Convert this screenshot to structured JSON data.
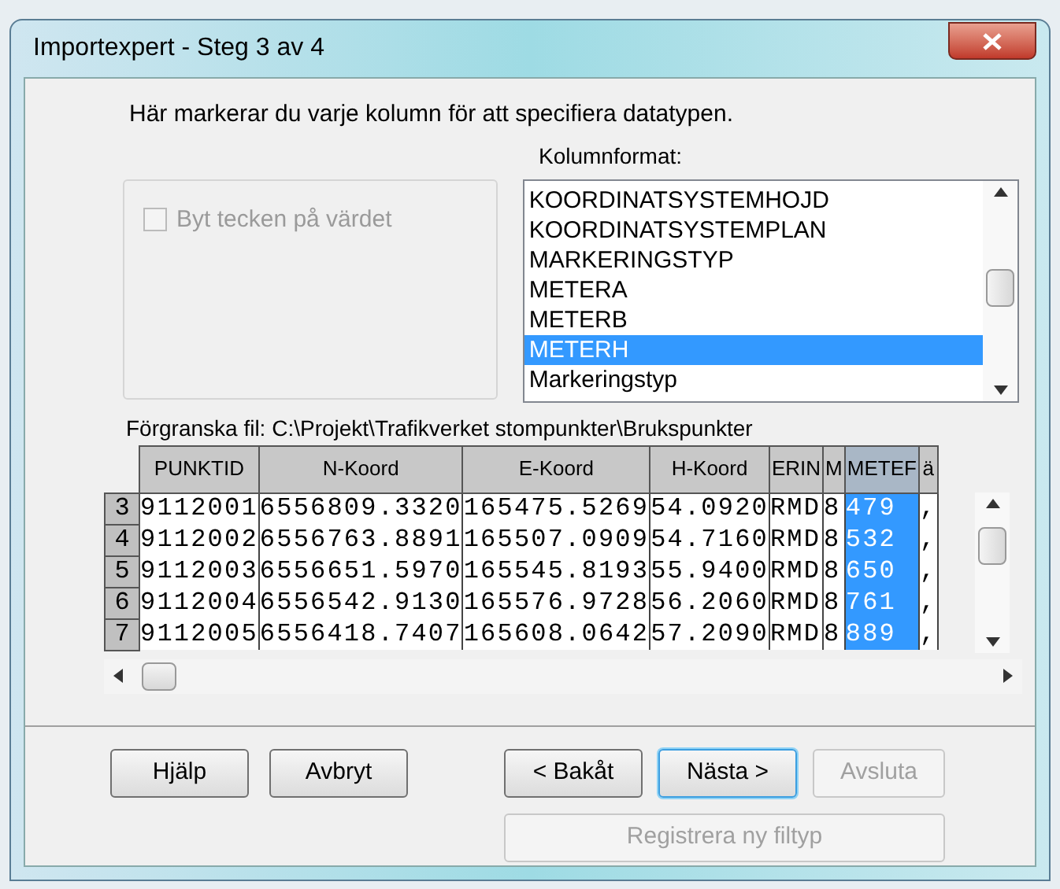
{
  "window": {
    "title": "Importexpert - Steg 3 av 4"
  },
  "instruction": "Här markerar du varje kolumn för att specifiera datatypen.",
  "column_format": {
    "label": "Kolumnformat:",
    "items": [
      {
        "label": "KOORDINATSYSTEMHOJD",
        "selected": false
      },
      {
        "label": "KOORDINATSYSTEMPLAN",
        "selected": false
      },
      {
        "label": "MARKERINGSTYP",
        "selected": false
      },
      {
        "label": "METERA",
        "selected": false
      },
      {
        "label": "METERB",
        "selected": false
      },
      {
        "label": "METERH",
        "selected": true
      },
      {
        "label": "Markeringstyp",
        "selected": false
      }
    ]
  },
  "negate_checkbox": {
    "label": "Byt tecken på värdet",
    "checked": false,
    "disabled": true
  },
  "preview": {
    "label": "Förgranska fil: C:\\Projekt\\Trafikverket stompunkter\\Brukspunkter",
    "columns": [
      {
        "label": "PUNKTID",
        "selected": false
      },
      {
        "label": "N-Koord",
        "selected": false
      },
      {
        "label": "E-Koord",
        "selected": false
      },
      {
        "label": "H-Koord",
        "selected": false
      },
      {
        "label": "ERIN",
        "selected": false
      },
      {
        "label": "M",
        "selected": false
      },
      {
        "label": "METEF",
        "selected": true
      },
      {
        "label": "ä",
        "selected": false
      }
    ],
    "rows": [
      {
        "number": "3",
        "cells": [
          "9112001",
          "6556809.3320",
          "165475.5269",
          "54.0920",
          "RMD",
          "8",
          "479",
          ","
        ]
      },
      {
        "number": "4",
        "cells": [
          "9112002",
          "6556763.8891",
          "165507.0909",
          "54.7160",
          "RMD",
          "8",
          "532",
          ","
        ]
      },
      {
        "number": "5",
        "cells": [
          "9112003",
          "6556651.5970",
          "165545.8193",
          "55.9400",
          "RMD",
          "8",
          "650",
          ","
        ]
      },
      {
        "number": "6",
        "cells": [
          "9112004",
          "6556542.9130",
          "165576.9728",
          "56.2060",
          "RMD",
          "8",
          "761",
          ","
        ]
      },
      {
        "number": "7",
        "cells": [
          "9112005",
          "6556418.7407",
          "165608.0642",
          "57.2090",
          "RMD",
          "8",
          "889",
          ","
        ]
      }
    ]
  },
  "buttons": [
    {
      "label": "Hjälp",
      "disabled": false,
      "default": false
    },
    {
      "label": "Avbryt",
      "disabled": false,
      "default": false
    },
    {
      "label": "< Bakåt",
      "disabled": false,
      "default": false
    },
    {
      "label": "Nästa >",
      "disabled": false,
      "default": true
    },
    {
      "label": "Avsluta",
      "disabled": true,
      "default": false
    },
    {
      "label": "Registrera ny filtyp",
      "disabled": true,
      "default": false
    }
  ]
}
